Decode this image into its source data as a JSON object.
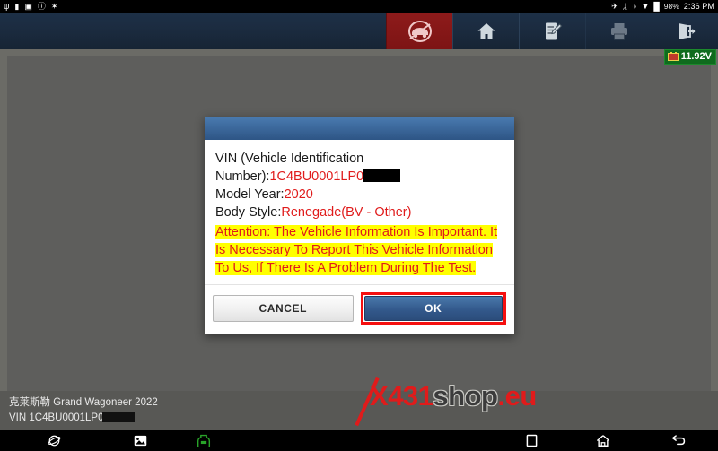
{
  "statusbar": {
    "left_icons": [
      {
        "name": "usb-debug-icon",
        "glyph": "ψ"
      },
      {
        "name": "sdcard-icon",
        "glyph": "▮"
      },
      {
        "name": "screenshot-icon",
        "glyph": "▣"
      },
      {
        "name": "pause-icon",
        "glyph": "ⓘ"
      },
      {
        "name": "vibrate-icon",
        "glyph": "✶"
      }
    ],
    "right_icons": [
      {
        "name": "location-icon",
        "glyph": "✈"
      },
      {
        "name": "bluetooth-icon",
        "glyph": "ᛦ"
      },
      {
        "name": "brightness-icon",
        "glyph": "◑"
      },
      {
        "name": "wifi-icon",
        "glyph": "▼"
      },
      {
        "name": "battery-icon",
        "glyph": "█"
      }
    ],
    "battery_percent": "98%",
    "clock": "2:36 PM"
  },
  "toolbar": {
    "buttons": [
      {
        "name": "vehicle-button",
        "icon": "car-icon",
        "label": "Vehicle",
        "active": true,
        "dim": false
      },
      {
        "name": "home-button",
        "icon": "home-icon",
        "label": "Home",
        "active": false,
        "dim": false
      },
      {
        "name": "report-button",
        "icon": "edit-report-icon",
        "label": "Report",
        "active": false,
        "dim": false
      },
      {
        "name": "print-button",
        "icon": "printer-icon",
        "label": "Print",
        "active": false,
        "dim": true
      },
      {
        "name": "exit-button",
        "icon": "exit-icon",
        "label": "Exit",
        "active": false,
        "dim": false
      }
    ]
  },
  "voltage_badge": {
    "value": "11.92V",
    "color": "#0f6b1e"
  },
  "dialog": {
    "title": "",
    "lines": [
      {
        "label": "VIN (Vehicle Identification",
        "value": "",
        "redacted": false
      },
      {
        "label": "Number):",
        "value": "1C4BU0001LP0",
        "redacted": true
      },
      {
        "label": "Model Year:",
        "value": "2020",
        "redacted": false
      },
      {
        "label": "Body Style:",
        "value": "Renegade(BV - Other)",
        "redacted": false
      }
    ],
    "attention_text": "Attention: The Vehicle Information Is Important. It Is Necessary To Report This Vehicle Information To Us, If There Is A Problem During The Test.",
    "attention_highlight_color": "#ffff00",
    "attention_text_color": "#e01b1b",
    "value_color": "#e01b1b",
    "cancel_label": "CANCEL",
    "ok_label": "OK",
    "ok_highlight_color": "#f50f0f"
  },
  "watermark": {
    "part1": "X",
    "part2": "431",
    "part3": "shop",
    "part4": ".eu",
    "red": "#e01b1b",
    "dark": "#3b3b3b"
  },
  "footer": {
    "vehicle": "克莱斯勒 Grand Wagoneer 2022",
    "vin_label": "VIN ",
    "vin_value": "1C4BU0001LP0"
  },
  "navbar": {
    "items": [
      {
        "name": "browser-nav-icon",
        "label": "Browser"
      },
      {
        "name": "gallery-nav-icon",
        "label": "Gallery"
      },
      {
        "name": "vci-nav-icon",
        "label": "VCI",
        "color": "#29a329"
      },
      {
        "name": "recents-nav-icon",
        "label": "Recents"
      },
      {
        "name": "home-nav-icon",
        "label": "Home"
      },
      {
        "name": "back-nav-icon",
        "label": "Back"
      }
    ]
  }
}
